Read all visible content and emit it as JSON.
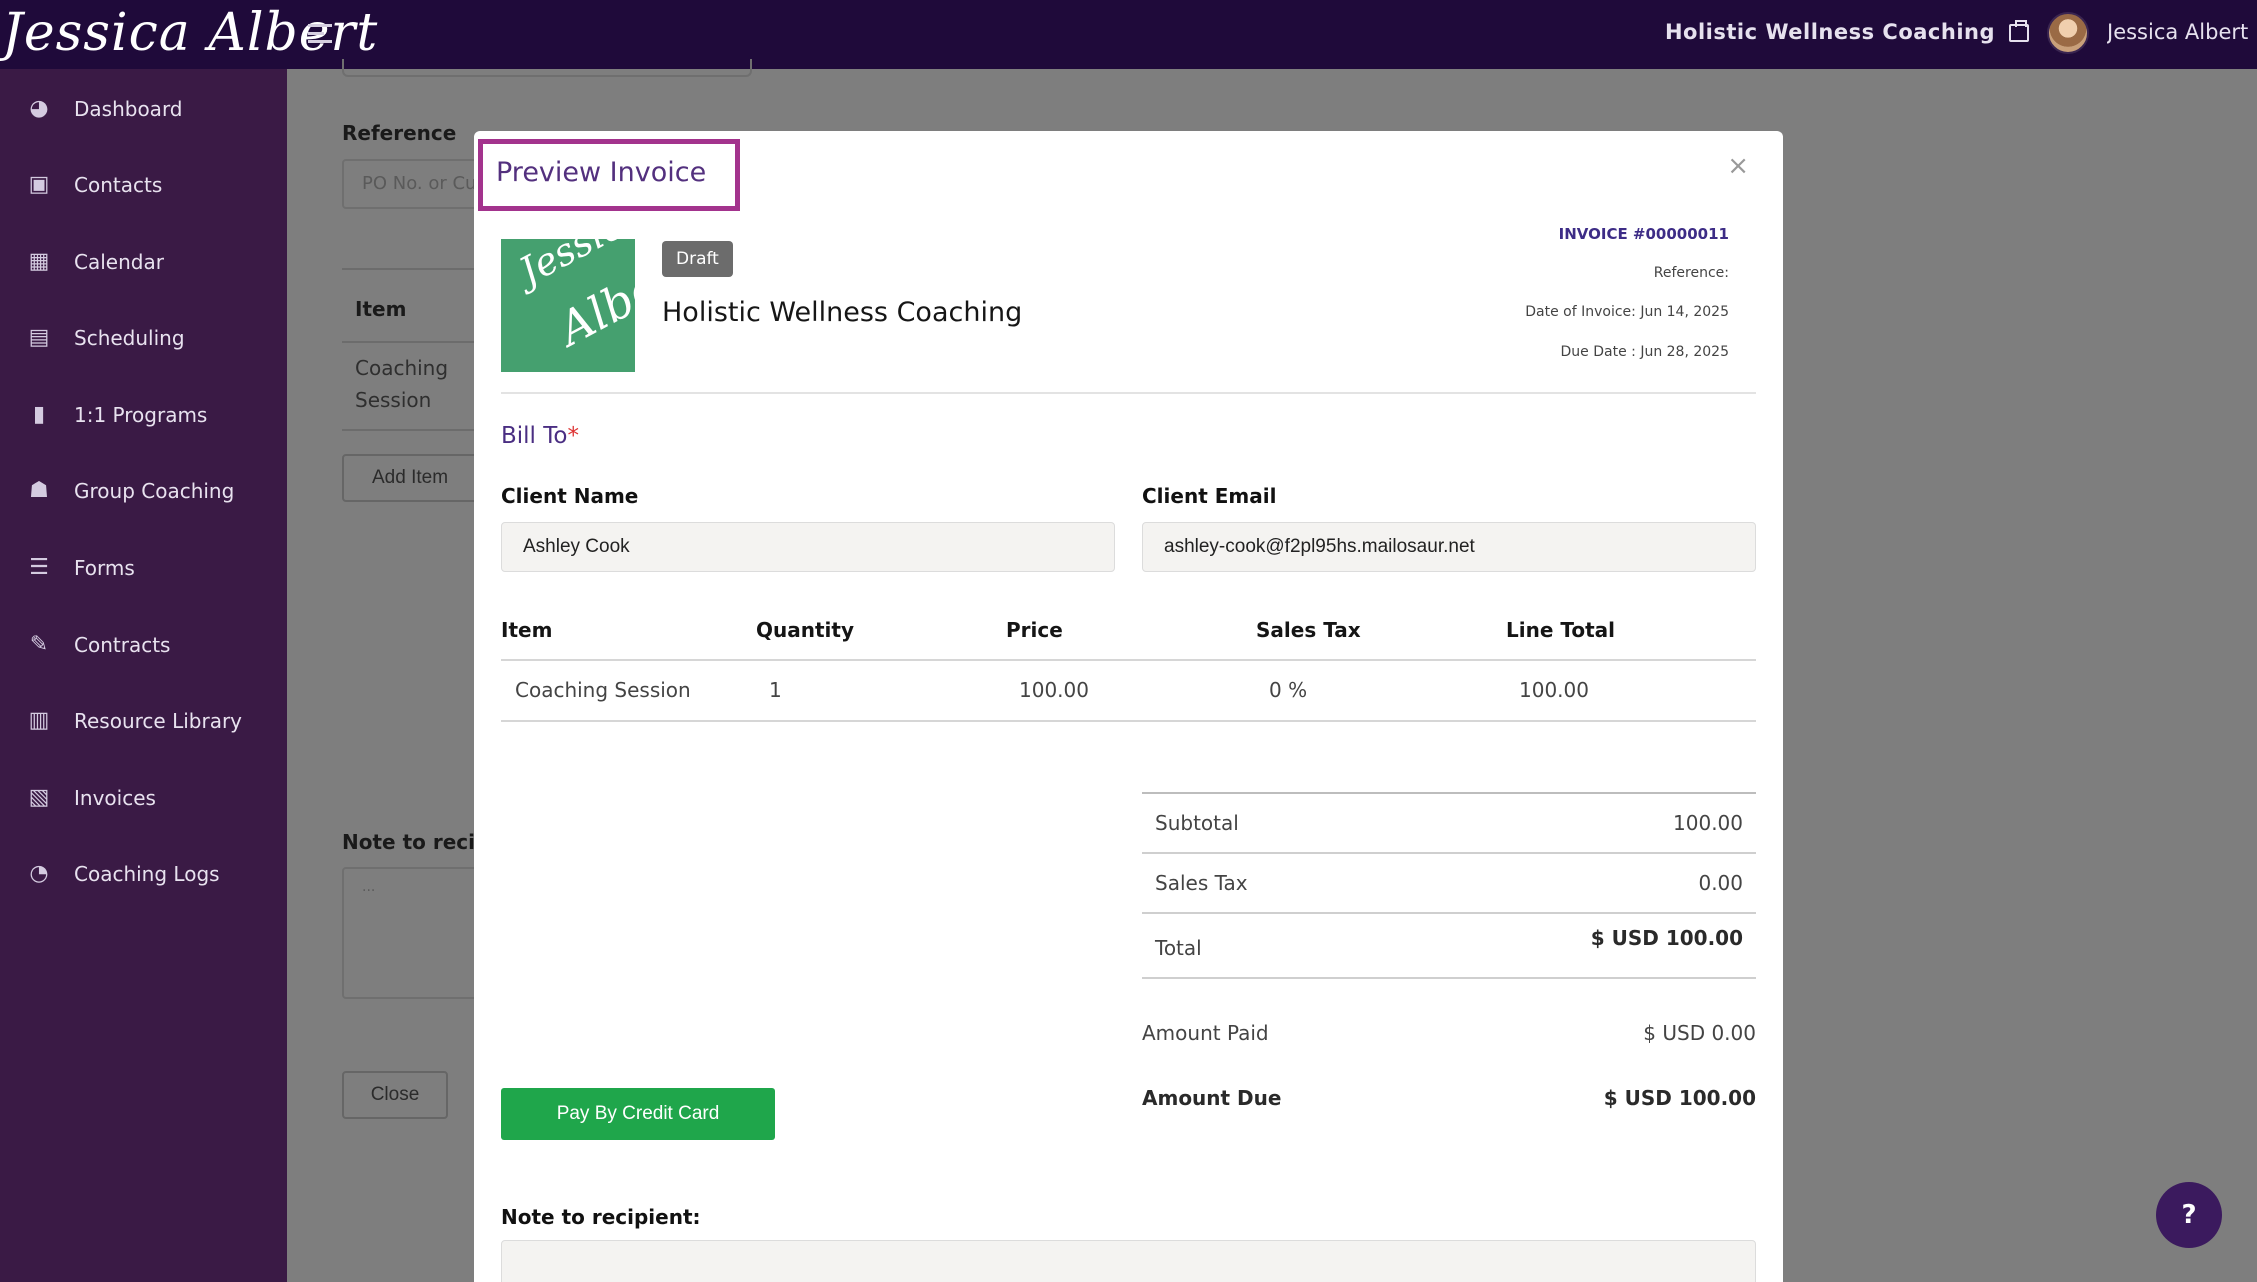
{
  "header": {
    "logo_text": "Jessica Albert",
    "business_name": "Holistic Wellness Coaching",
    "user_name": "Jessica Albert"
  },
  "sidebar": {
    "items": [
      {
        "label": "Dashboard",
        "icon": "dashboard-icon"
      },
      {
        "label": "Contacts",
        "icon": "contacts-icon"
      },
      {
        "label": "Calendar",
        "icon": "calendar-icon"
      },
      {
        "label": "Scheduling",
        "icon": "scheduling-icon"
      },
      {
        "label": "1:1 Programs",
        "icon": "book-icon"
      },
      {
        "label": "Group Coaching",
        "icon": "group-icon"
      },
      {
        "label": "Forms",
        "icon": "forms-icon"
      },
      {
        "label": "Contracts",
        "icon": "contracts-icon"
      },
      {
        "label": "Resource Library",
        "icon": "library-icon"
      },
      {
        "label": "Invoices",
        "icon": "invoice-icon"
      },
      {
        "label": "Coaching Logs",
        "icon": "clock-icon"
      }
    ]
  },
  "background_page": {
    "reference_label": "Reference",
    "reference_placeholder": "PO No. or Cu",
    "item_header": "Item",
    "item_value": "Coaching Session",
    "add_item_button": "Add Item",
    "note_label": "Note to recip",
    "note_placeholder": "...",
    "close_button": "Close"
  },
  "modal": {
    "title": "Preview Invoice",
    "close_symbol": "×",
    "logo_line1": "Jessica",
    "logo_line2": "Albert",
    "status_badge": "Draft",
    "company_name": "Holistic Wellness Coaching",
    "invoice_number": "INVOICE #00000011",
    "reference_line": "Reference:",
    "date_of_invoice": "Date of Invoice: Jun 14, 2025",
    "due_date": "Due Date : Jun 28, 2025",
    "bill_to": "Bill To",
    "required_mark": "*",
    "client_name_label": "Client Name",
    "client_name_value": "Ashley Cook",
    "client_email_label": "Client Email",
    "client_email_value": "ashley-cook@f2pl95hs.mailosaur.net",
    "table": {
      "headers": [
        "Item",
        "Quantity",
        "Price",
        "Sales Tax",
        "Line Total"
      ],
      "rows": [
        [
          "Coaching Session",
          "1",
          "100.00",
          "0 %",
          "100.00"
        ]
      ]
    },
    "summary": {
      "subtotal_label": "Subtotal",
      "subtotal_value": "100.00",
      "sales_tax_label": "Sales Tax",
      "sales_tax_value": "0.00",
      "total_label": "Total",
      "total_value": "$ USD 100.00",
      "amount_paid_label": "Amount Paid",
      "amount_paid_value": "$ USD 0.00",
      "amount_due_label": "Amount Due",
      "amount_due_value": "$ USD 100.00"
    },
    "pay_button": "Pay By Credit Card",
    "note_label": "Note to recipient:"
  },
  "help_button": "?",
  "colors": {
    "topbar": "#1f0a3a",
    "sidebar": "#3a1a45",
    "accent_purple": "#53307e",
    "highlight_border": "#a3338d",
    "pay_green": "#1fa64b",
    "logo_green": "#45a06f"
  }
}
